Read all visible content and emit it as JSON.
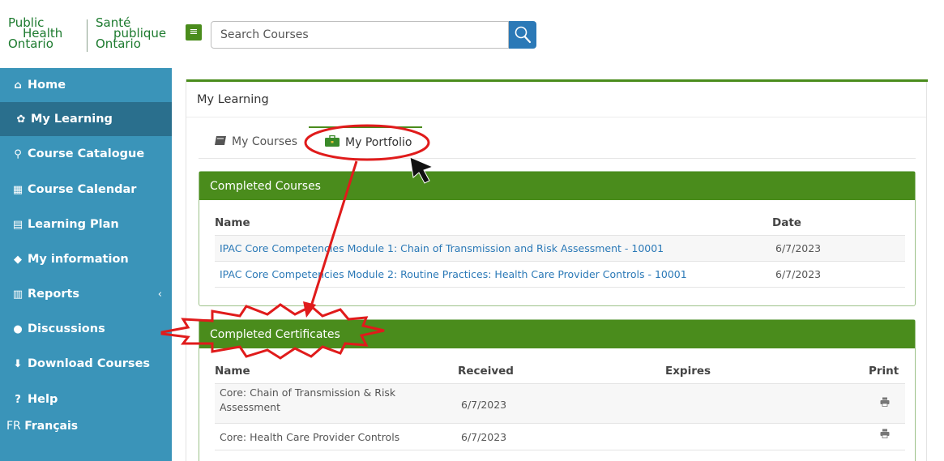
{
  "logo": {
    "en": [
      "Public",
      "Health",
      "Ontario"
    ],
    "fr": [
      "Santé",
      "publique",
      "Ontario"
    ]
  },
  "header": {
    "menu_icon": "bars-icon",
    "search_placeholder": "Search Courses",
    "search_icon": "magnifier-icon"
  },
  "sidebar": {
    "items": [
      {
        "icon": "home-icon",
        "glyph": "⌂",
        "label": "Home"
      },
      {
        "icon": "leaf-icon",
        "glyph": "✿",
        "label": "My Learning"
      },
      {
        "icon": "search-icon",
        "glyph": "⚲",
        "label": "Course Catalogue"
      },
      {
        "icon": "calendar-icon",
        "glyph": "▦",
        "label": "Course Calendar"
      },
      {
        "icon": "file-icon",
        "glyph": "▤",
        "label": "Learning Plan"
      },
      {
        "icon": "graduation-cap-icon",
        "glyph": "◆",
        "label": "My information"
      },
      {
        "icon": "bar-chart-icon",
        "glyph": "▥",
        "label": "Reports"
      },
      {
        "icon": "comments-icon",
        "glyph": "●",
        "label": "Discussions"
      },
      {
        "icon": "download-icon",
        "glyph": "⬇",
        "label": "Download Courses"
      },
      {
        "icon": "question-circle-icon",
        "glyph": "?",
        "label": "Help"
      }
    ],
    "reports_chevron": "‹",
    "lang_prefix": "FR",
    "lang_label": "Français"
  },
  "main": {
    "title": "My Learning",
    "tabs": [
      {
        "icon": "book-icon",
        "label": "My Courses"
      },
      {
        "icon": "briefcase-icon",
        "label": "My Portfolio"
      }
    ]
  },
  "completed_courses": {
    "heading": "Completed Courses",
    "columns": [
      "Name",
      "Date"
    ],
    "rows": [
      {
        "name": "IPAC Core Competencies Module 1: Chain of Transmission and Risk Assessment - 10001",
        "date": "6/7/2023"
      },
      {
        "name": "IPAC Core Competencies Module 2: Routine Practices: Health Care Provider Controls - 10001",
        "date": "6/7/2023"
      }
    ]
  },
  "completed_certificates": {
    "heading": "Completed Certificates",
    "columns": [
      "Name",
      "Received",
      "Expires",
      "Print"
    ],
    "rows": [
      {
        "name_line1": "Core: Chain of Transmission & Risk",
        "name_line2": "Assessment",
        "received": "6/7/2023",
        "expires": "",
        "print_icon": "print-icon"
      },
      {
        "name_line1": "Core: Health Care Provider Controls",
        "name_line2": "",
        "received": "6/7/2023",
        "expires": "",
        "print_icon": "print-icon"
      }
    ]
  },
  "colors": {
    "green": "#4a8c1c",
    "sidebar": "#3a94b9",
    "sidebar_active": "#2a6f8d",
    "link": "#2b79b7",
    "annotation": "#e01b1b"
  }
}
